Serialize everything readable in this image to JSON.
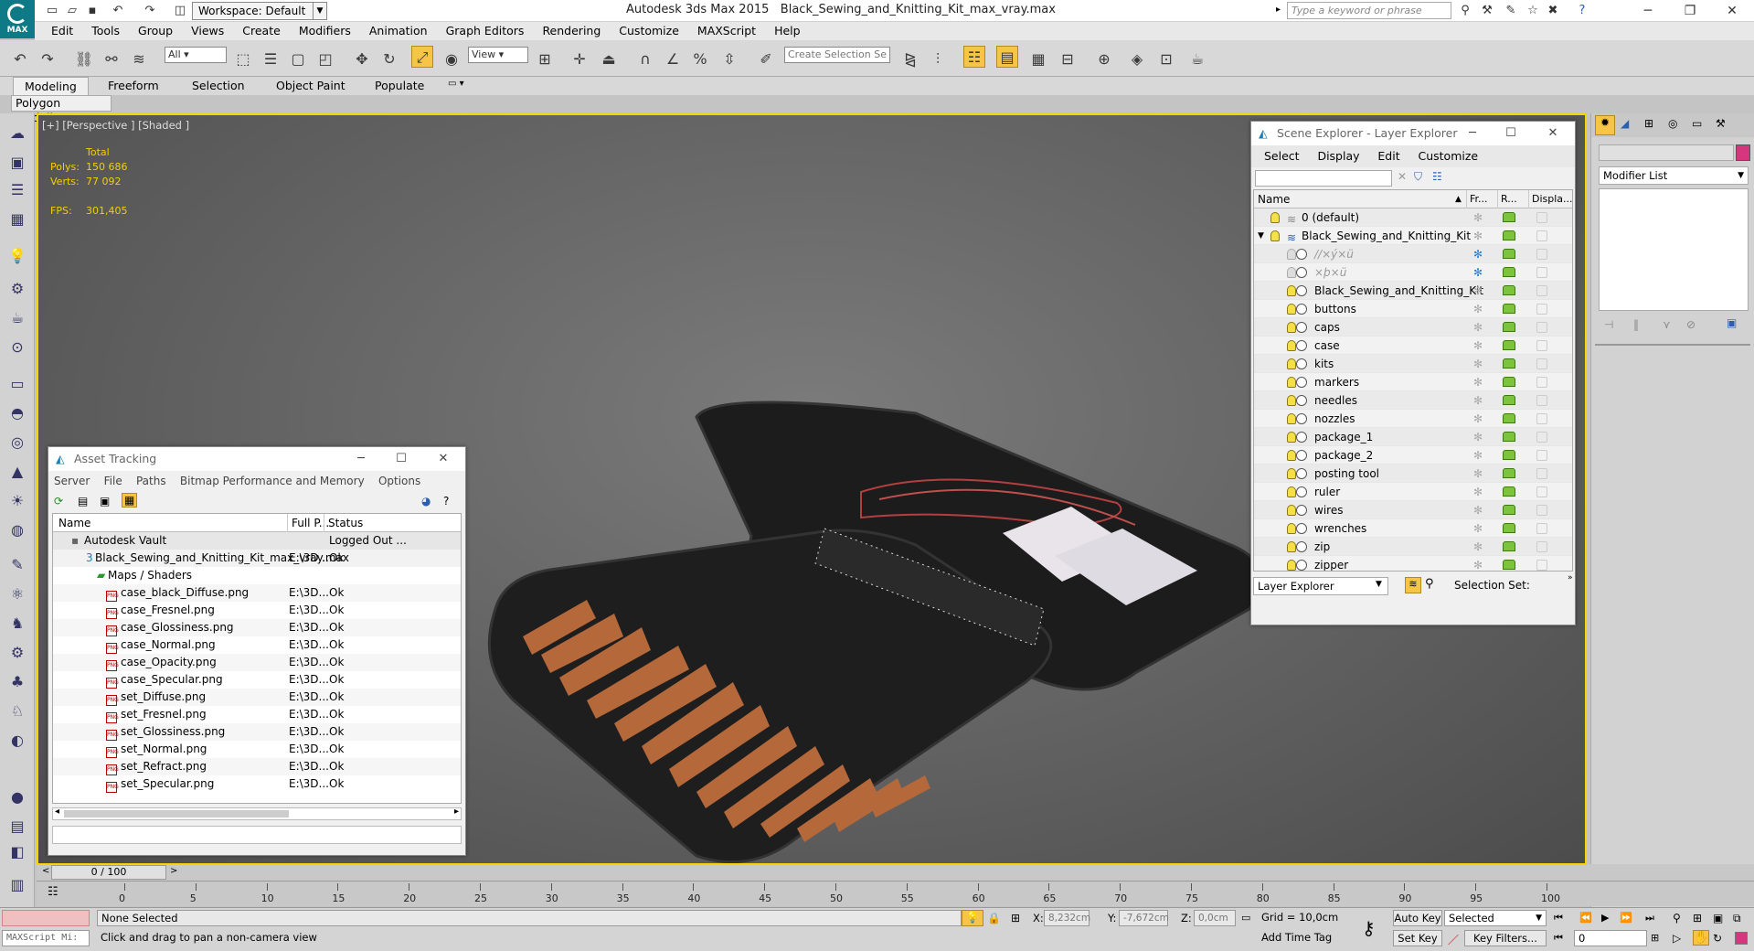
{
  "app": {
    "title": "Autodesk 3ds Max  2015",
    "file": "Black_Sewing_and_Knitting_Kit_max_vray.max",
    "workspace": "Workspace: Default",
    "search_placeholder": "Type a keyword or phrase",
    "logo_text": "MAX"
  },
  "menu": [
    "Edit",
    "Tools",
    "Group",
    "Views",
    "Create",
    "Modifiers",
    "Animation",
    "Graph Editors",
    "Rendering",
    "Customize",
    "MAXScript",
    "Help"
  ],
  "toolbar": {
    "filter_value": "All",
    "view_value": "View",
    "selection_set_placeholder": "Create Selection Se"
  },
  "ribbon": {
    "tabs": [
      "Modeling",
      "Freeform",
      "Selection",
      "Object Paint",
      "Populate"
    ],
    "active_panel": "Polygon Modeling"
  },
  "viewport": {
    "label": "[+] [Perspective ] [Shaded ]",
    "stats": {
      "total_label": "Total",
      "polys_label": "Polys:",
      "polys_value": "150 686",
      "verts_label": "Verts:",
      "verts_value": "77 092",
      "fps_label": "FPS:",
      "fps_value": "301,405"
    }
  },
  "asset_tracking": {
    "title": "Asset Tracking",
    "menu": [
      "Server",
      "File",
      "Paths",
      "Bitmap Performance and Memory",
      "Options"
    ],
    "columns": [
      "Name",
      "Full P...",
      "Status"
    ],
    "root": {
      "name": "Autodesk Vault",
      "status": "Logged Out ..."
    },
    "file": {
      "name": "Black_Sewing_and_Knitting_Kit_max_vray.max",
      "path": "E:\\3D...",
      "status": "Ok"
    },
    "folder": "Maps / Shaders",
    "maps": [
      {
        "name": "case_black_Diffuse.png",
        "path": "E:\\3D...",
        "status": "Ok"
      },
      {
        "name": "case_Fresnel.png",
        "path": "E:\\3D...",
        "status": "Ok"
      },
      {
        "name": "case_Glossiness.png",
        "path": "E:\\3D...",
        "status": "Ok"
      },
      {
        "name": "case_Normal.png",
        "path": "E:\\3D...",
        "status": "Ok"
      },
      {
        "name": "case_Opacity.png",
        "path": "E:\\3D...",
        "status": "Ok"
      },
      {
        "name": "case_Specular.png",
        "path": "E:\\3D...",
        "status": "Ok"
      },
      {
        "name": "set_Diffuse.png",
        "path": "E:\\3D...",
        "status": "Ok"
      },
      {
        "name": "set_Fresnel.png",
        "path": "E:\\3D...",
        "status": "Ok"
      },
      {
        "name": "set_Glossiness.png",
        "path": "E:\\3D...",
        "status": "Ok"
      },
      {
        "name": "set_Normal.png",
        "path": "E:\\3D...",
        "status": "Ok"
      },
      {
        "name": "set_Refract.png",
        "path": "E:\\3D...",
        "status": "Ok"
      },
      {
        "name": "set_Specular.png",
        "path": "E:\\3D...",
        "status": "Ok"
      }
    ]
  },
  "scene_explorer": {
    "title": "Scene Explorer - Layer Explorer",
    "menu": [
      "Select",
      "Display",
      "Edit",
      "Customize"
    ],
    "columns": [
      "Name",
      "Fr...",
      "R...",
      "Displa..."
    ],
    "layers": [
      {
        "name": "0 (default)",
        "level": 0,
        "type": "layer"
      },
      {
        "name": "Black_Sewing_and_Knitting_Kit",
        "level": 0,
        "type": "layer-active"
      },
      {
        "name": "//×ý×ü",
        "level": 1,
        "type": "hidden"
      },
      {
        "name": "×þ×ü",
        "level": 1,
        "type": "hidden"
      },
      {
        "name": "Black_Sewing_and_Knitting_Kit",
        "level": 1,
        "type": "object"
      },
      {
        "name": "buttons",
        "level": 1,
        "type": "object"
      },
      {
        "name": "caps",
        "level": 1,
        "type": "object"
      },
      {
        "name": "case",
        "level": 1,
        "type": "object"
      },
      {
        "name": "kits",
        "level": 1,
        "type": "object"
      },
      {
        "name": "markers",
        "level": 1,
        "type": "object"
      },
      {
        "name": "needles",
        "level": 1,
        "type": "object"
      },
      {
        "name": "nozzles",
        "level": 1,
        "type": "object"
      },
      {
        "name": "package_1",
        "level": 1,
        "type": "object"
      },
      {
        "name": "package_2",
        "level": 1,
        "type": "object"
      },
      {
        "name": "posting tool",
        "level": 1,
        "type": "object"
      },
      {
        "name": "ruler",
        "level": 1,
        "type": "object"
      },
      {
        "name": "wires",
        "level": 1,
        "type": "object"
      },
      {
        "name": "wrenches",
        "level": 1,
        "type": "object"
      },
      {
        "name": "zip",
        "level": 1,
        "type": "object"
      },
      {
        "name": "zipper",
        "level": 1,
        "type": "object"
      }
    ],
    "footer_dropdown": "Layer Explorer",
    "selection_set_label": "Selection Set:"
  },
  "command_panel": {
    "modifier_list": "Modifier List",
    "accent_color": "#d4377e"
  },
  "timeline": {
    "frame": "0 / 100",
    "ticks": [
      "0",
      "5",
      "10",
      "15",
      "20",
      "25",
      "30",
      "35",
      "40",
      "45",
      "50",
      "55",
      "60",
      "65",
      "70",
      "75",
      "80",
      "85",
      "90",
      "95",
      "100"
    ]
  },
  "status": {
    "maxscript": "MAXScript Mi:",
    "selection": "None Selected",
    "prompt": "Click and drag to pan a non-camera view",
    "x_label": "X:",
    "x_value": "8,232cm",
    "y_label": "Y:",
    "y_value": "-7,672cm",
    "z_label": "Z:",
    "z_value": "0,0cm",
    "grid": "Grid = 10,0cm",
    "add_time_tag": "Add Time Tag",
    "auto_key": "Auto Key",
    "set_key": "Set Key",
    "selected": "Selected",
    "key_filters": "Key Filters...",
    "frame_value": "0"
  }
}
